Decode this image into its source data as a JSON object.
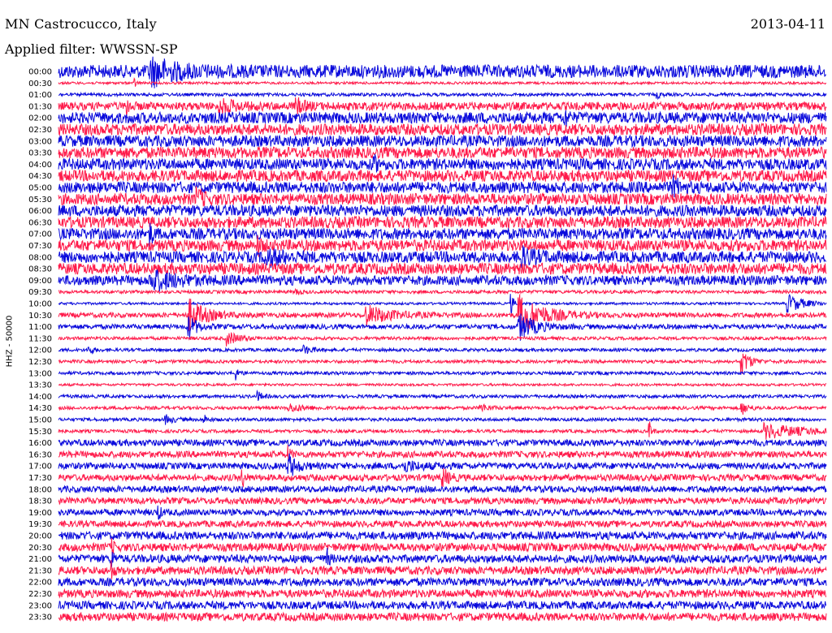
{
  "header": {
    "station": "MN Castrocucco, Italy",
    "date": "2013-04-11",
    "filter": "Applied filter: WWSSN-SP"
  },
  "chart_data": {
    "type": "line",
    "title": "MN Castrocucco, Italy",
    "ylabel": "HHZ - 50000",
    "colors": [
      "#0a0adc",
      "#ff1a4a"
    ],
    "rows": [
      {
        "label": "00:00",
        "amp": 8,
        "events": [
          {
            "x": 0.12,
            "a": 16,
            "w": 0.03
          }
        ]
      },
      {
        "label": "00:30",
        "amp": 1.5,
        "events": [
          {
            "x": 0.1,
            "a": 5,
            "w": 0.002
          }
        ]
      },
      {
        "label": "01:00",
        "amp": 2,
        "events": [
          {
            "x": 0.78,
            "a": 4,
            "w": 0.004
          }
        ]
      },
      {
        "label": "01:30",
        "amp": 5,
        "events": [
          {
            "x": 0.09,
            "a": 9,
            "w": 0.004
          },
          {
            "x": 0.21,
            "a": 8,
            "w": 0.02
          },
          {
            "x": 0.31,
            "a": 8,
            "w": 0.01
          }
        ]
      },
      {
        "label": "02:00",
        "amp": 7,
        "events": [
          {
            "x": 0.66,
            "a": 11,
            "w": 0.003
          }
        ]
      },
      {
        "label": "02:30",
        "amp": 7,
        "events": []
      },
      {
        "label": "03:00",
        "amp": 7,
        "events": []
      },
      {
        "label": "03:30",
        "amp": 7,
        "events": []
      },
      {
        "label": "04:00",
        "amp": 7,
        "events": [
          {
            "x": 0.41,
            "a": 10,
            "w": 0.004
          }
        ]
      },
      {
        "label": "04:30",
        "amp": 7,
        "events": []
      },
      {
        "label": "05:00",
        "amp": 7,
        "events": [
          {
            "x": 0.8,
            "a": 10,
            "w": 0.01
          }
        ]
      },
      {
        "label": "05:30",
        "amp": 7,
        "events": [
          {
            "x": 0.18,
            "a": 10,
            "w": 0.01
          }
        ]
      },
      {
        "label": "06:00",
        "amp": 7,
        "events": []
      },
      {
        "label": "06:30",
        "amp": 7,
        "events": []
      },
      {
        "label": "07:00",
        "amp": 7,
        "events": [
          {
            "x": 0.12,
            "a": 11,
            "w": 0.003
          }
        ]
      },
      {
        "label": "07:30",
        "amp": 7,
        "events": [
          {
            "x": 0.26,
            "a": 10,
            "w": 0.004
          }
        ]
      },
      {
        "label": "08:00",
        "amp": 7,
        "events": [
          {
            "x": 0.27,
            "a": 9,
            "w": 0.02
          },
          {
            "x": 0.6,
            "a": 10,
            "w": 0.02
          }
        ]
      },
      {
        "label": "08:30",
        "amp": 7,
        "events": []
      },
      {
        "label": "09:00",
        "amp": 6,
        "events": [
          {
            "x": 0.12,
            "a": 12,
            "w": 0.03
          }
        ]
      },
      {
        "label": "09:30",
        "amp": 2,
        "events": [
          {
            "x": 0.31,
            "a": 5,
            "w": 0.004
          }
        ]
      },
      {
        "label": "10:00",
        "amp": 1.5,
        "events": [
          {
            "x": 0.59,
            "a": 12,
            "w": 0.003
          },
          {
            "x": 0.95,
            "a": 11,
            "w": 0.02
          }
        ]
      },
      {
        "label": "10:30",
        "amp": 3,
        "events": [
          {
            "x": 0.17,
            "a": 20,
            "w": 0.02
          },
          {
            "x": 0.4,
            "a": 12,
            "w": 0.03
          },
          {
            "x": 0.6,
            "a": 24,
            "w": 0.03
          }
        ]
      },
      {
        "label": "11:00",
        "amp": 3,
        "events": [
          {
            "x": 0.17,
            "a": 14,
            "w": 0.01
          },
          {
            "x": 0.6,
            "a": 16,
            "w": 0.02
          }
        ]
      },
      {
        "label": "11:30",
        "amp": 2,
        "events": [
          {
            "x": 0.22,
            "a": 8,
            "w": 0.015
          }
        ]
      },
      {
        "label": "12:00",
        "amp": 2,
        "events": [
          {
            "x": 0.04,
            "a": 5,
            "w": 0.005
          },
          {
            "x": 0.32,
            "a": 5,
            "w": 0.01
          }
        ]
      },
      {
        "label": "12:30",
        "amp": 2,
        "events": [
          {
            "x": 0.89,
            "a": 16,
            "w": 0.01
          }
        ]
      },
      {
        "label": "13:00",
        "amp": 2,
        "events": [
          {
            "x": 0.23,
            "a": 9,
            "w": 0.004
          }
        ]
      },
      {
        "label": "13:30",
        "amp": 1.5,
        "events": []
      },
      {
        "label": "14:00",
        "amp": 2,
        "events": [
          {
            "x": 0.26,
            "a": 5,
            "w": 0.006
          }
        ]
      },
      {
        "label": "14:30",
        "amp": 2,
        "events": [
          {
            "x": 0.3,
            "a": 5,
            "w": 0.02
          },
          {
            "x": 0.55,
            "a": 5,
            "w": 0.01
          },
          {
            "x": 0.89,
            "a": 8,
            "w": 0.008
          }
        ]
      },
      {
        "label": "15:00",
        "amp": 2,
        "events": [
          {
            "x": 0.14,
            "a": 5,
            "w": 0.01
          },
          {
            "x": 0.19,
            "a": 5,
            "w": 0.005
          }
        ]
      },
      {
        "label": "15:30",
        "amp": 2,
        "events": [
          {
            "x": 0.77,
            "a": 10,
            "w": 0.003
          },
          {
            "x": 0.92,
            "a": 9,
            "w": 0.05
          }
        ]
      },
      {
        "label": "16:00",
        "amp": 4,
        "events": []
      },
      {
        "label": "16:30",
        "amp": 4,
        "events": [
          {
            "x": 0.3,
            "a": 8,
            "w": 0.003
          }
        ]
      },
      {
        "label": "17:00",
        "amp": 4,
        "events": [
          {
            "x": 0.3,
            "a": 14,
            "w": 0.01
          },
          {
            "x": 0.45,
            "a": 6,
            "w": 0.02
          }
        ]
      },
      {
        "label": "17:30",
        "amp": 4,
        "events": [
          {
            "x": 0.24,
            "a": 10,
            "w": 0.003
          },
          {
            "x": 0.5,
            "a": 11,
            "w": 0.008
          }
        ]
      },
      {
        "label": "18:00",
        "amp": 4,
        "events": []
      },
      {
        "label": "18:30",
        "amp": 4,
        "events": []
      },
      {
        "label": "19:00",
        "amp": 4,
        "events": [
          {
            "x": 0.13,
            "a": 9,
            "w": 0.003
          }
        ]
      },
      {
        "label": "19:30",
        "amp": 4,
        "events": []
      },
      {
        "label": "20:00",
        "amp": 5,
        "events": []
      },
      {
        "label": "20:30",
        "amp": 5,
        "events": [
          {
            "x": 0.07,
            "a": 10,
            "w": 0.002
          }
        ]
      },
      {
        "label": "21:00",
        "amp": 5,
        "events": [
          {
            "x": 0.07,
            "a": 12,
            "w": 0.002
          },
          {
            "x": 0.35,
            "a": 9,
            "w": 0.003
          }
        ]
      },
      {
        "label": "21:30",
        "amp": 5,
        "events": [
          {
            "x": 0.07,
            "a": 11,
            "w": 0.002
          }
        ]
      },
      {
        "label": "22:00",
        "amp": 5,
        "events": []
      },
      {
        "label": "22:30",
        "amp": 5,
        "events": []
      },
      {
        "label": "23:00",
        "amp": 5,
        "events": []
      },
      {
        "label": "23:30",
        "amp": 5,
        "events": []
      }
    ]
  }
}
